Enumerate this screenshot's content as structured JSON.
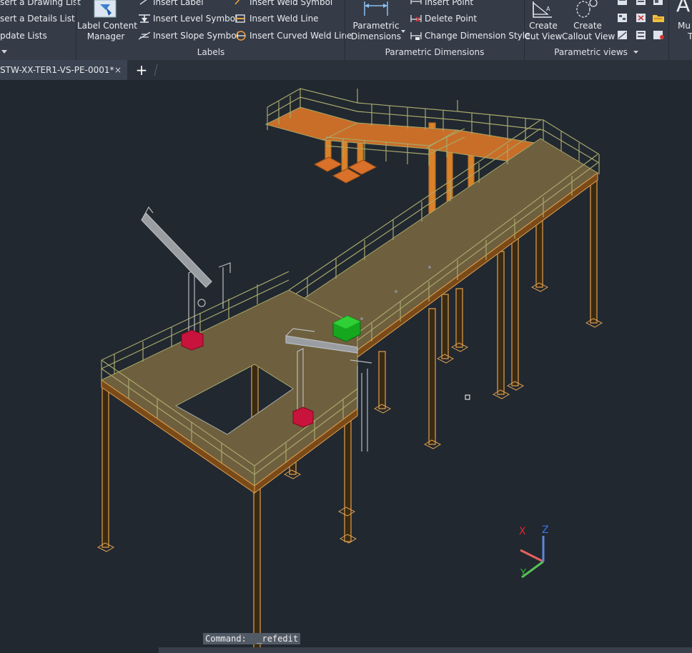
{
  "ribbon": {
    "col1": [
      "sert a Drawing List",
      "sert a Details List",
      "pdate Lists"
    ],
    "label_content_manager": [
      "Label Content",
      "Manager"
    ],
    "labels_col2": [
      "Insert Label",
      "Insert Level Symbol",
      "Insert Slope Symbol"
    ],
    "labels_col3": [
      "Insert Weld Symbol",
      "Insert Weld Line",
      "Insert Curved Weld Line"
    ],
    "labels_group": "Labels",
    "param_dims_button": [
      "Parametric",
      "Dimensions"
    ],
    "param_dims_items": [
      "Insert Point",
      "Delete Point",
      "Change Dimension Style"
    ],
    "param_dims_group": "Parametric Dimensions",
    "create_cut_view": [
      "Create",
      "Cut View"
    ],
    "create_callout_view": [
      "Create",
      "Callout View"
    ],
    "param_views_group": "Parametric views",
    "multi_partial": [
      "Mu",
      "T"
    ]
  },
  "tabs": [
    {
      "label": "STW-XX-TER1-VS-PE-0001*",
      "close": "×"
    }
  ],
  "add_tab": "+",
  "command_line": "Command:  _refedit",
  "ucs": {
    "x": "X",
    "y": "Y",
    "z": "Z"
  },
  "colors": {
    "background": "#212830",
    "ribbon": "#353c48",
    "steel": "#e0a050",
    "deck": "#6e5f3e",
    "railing": "#a7a86a",
    "grating": "#c86e28",
    "crane_base": "#c8143c",
    "green_box": "#15a81e"
  }
}
